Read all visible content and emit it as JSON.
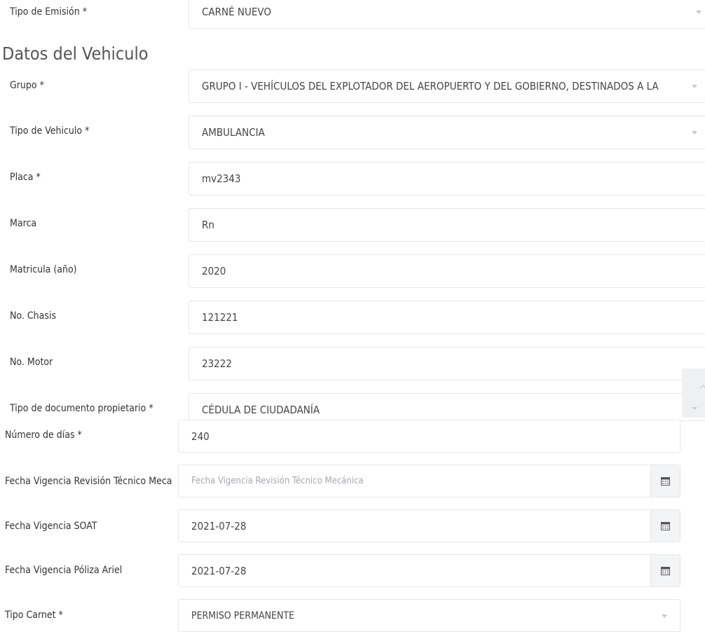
{
  "emission": {
    "label": "Tipo de Emisión *",
    "value": "CARNÉ NUEVO"
  },
  "section_title": "Datos del Vehiculo",
  "vehicle": {
    "grupo": {
      "label": "Grupo *",
      "value": "GRUPO I - VEHÍCULOS DEL EXPLOTADOR DEL AEROPUERTO Y DEL GOBIERNO, DESTINADOS A LA"
    },
    "tipo_vehiculo": {
      "label": "Tipo de Vehiculo *",
      "value": "AMBULANCIA"
    },
    "placa": {
      "label": "Placa *",
      "value": "mv2343"
    },
    "marca": {
      "label": "Marca",
      "value": "Rn"
    },
    "matricula": {
      "label": "Matricula (año)",
      "value": "2020"
    },
    "chasis": {
      "label": "No. Chasis",
      "value": "121221"
    },
    "motor": {
      "label": "No. Motor",
      "value": "23222"
    },
    "tipo_documento": {
      "label": "Tipo de documento propietario *",
      "value": "CÉDULA DE CIUDADANÍA"
    }
  },
  "permit": {
    "dias": {
      "label": "Número de días *",
      "value": "240"
    },
    "revision": {
      "label": "Fecha Vigencia Revisión Técnico Meca",
      "value": "",
      "placeholder": "Fecha Vigencia Revisión Técnico Mecánica"
    },
    "soat": {
      "label": "Fecha Vigencia SOAT",
      "value": "2021-07-28"
    },
    "poliza": {
      "label": "Fecha Vigencia Póliza Ariel",
      "value": "2021-07-28"
    },
    "tipo_carnet": {
      "label": "Tipo Carnet *",
      "value": "PERMISO PERMANENTE"
    }
  },
  "icons": {
    "calendar": "calendar-icon",
    "dropdown": "chevron-down-icon",
    "scroll": "scroll-arrows-icon"
  }
}
